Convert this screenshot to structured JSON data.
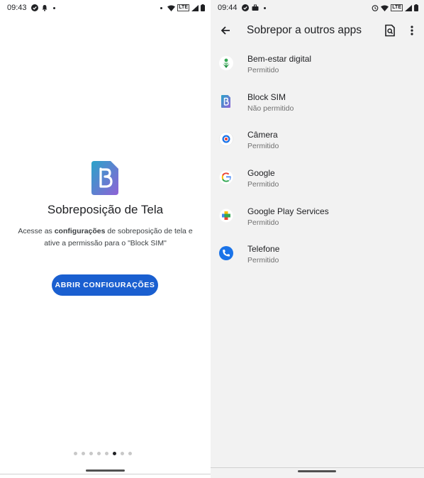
{
  "left": {
    "status": {
      "time": "09:43"
    },
    "onboarding": {
      "title": "Sobreposição de Tela",
      "desc_prefix": "Acesse as ",
      "desc_bold": "configurações",
      "desc_suffix": " de sobreposição de tela e ative a permissão para o \"Block SIM\"",
      "button": "ABRIR CONFIGURAÇÕES"
    },
    "pager": {
      "total": 8,
      "active_index": 5
    }
  },
  "right": {
    "status": {
      "time": "09:44"
    },
    "appbar": {
      "title": "Sobrepor a outros apps"
    },
    "apps": [
      {
        "name": "Bem-estar digital",
        "status": "Permitido",
        "icon": "digital-wellbeing-icon"
      },
      {
        "name": "Block SIM",
        "status": "Não permitido",
        "icon": "block-sim-icon"
      },
      {
        "name": "Câmera",
        "status": "Permitido",
        "icon": "camera-icon"
      },
      {
        "name": "Google",
        "status": "Permitido",
        "icon": "google-icon"
      },
      {
        "name": "Google Play Services",
        "status": "Permitido",
        "icon": "google-play-services-icon"
      },
      {
        "name": "Telefone",
        "status": "Permitido",
        "icon": "phone-icon"
      }
    ]
  },
  "colors": {
    "accent": "#1a5fd0",
    "logo_gradient": [
      "#2aa3c9",
      "#8e62d6"
    ]
  }
}
